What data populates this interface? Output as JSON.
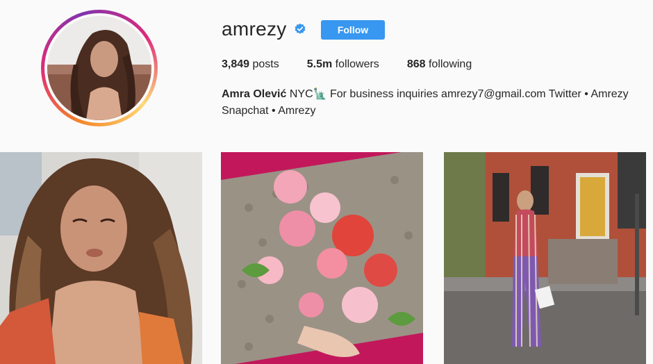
{
  "profile": {
    "username": "amrezy",
    "follow_label": "Follow",
    "stats": {
      "posts_value": "3,849",
      "posts_label": "posts",
      "followers_value": "5.5m",
      "followers_label": "followers",
      "following_value": "868",
      "following_label": "following"
    },
    "bio": {
      "name": "Amra Olević",
      "text_line1": " NYC🗽 For business inquiries amrezy7@gmail.com Twitter • Amrezy",
      "text_line2": "Snapchat • Amrezy"
    }
  },
  "icons": {
    "verified": "verified-badge-icon"
  },
  "colors": {
    "follow_button": "#3897f0",
    "verified_badge": "#3897f0",
    "background": "#fafafa"
  }
}
